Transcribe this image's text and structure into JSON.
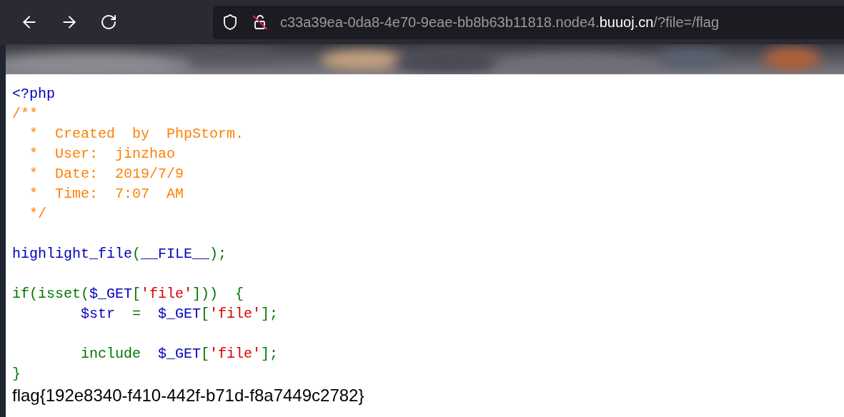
{
  "browser": {
    "url": {
      "prefix": "c33a39ea-0da8-4e70-9eae-bb8b63b11818.node4.",
      "domain": "buuoj.cn",
      "suffix": "/?file=/flag"
    }
  },
  "code": {
    "lines": [
      {
        "kind": "code",
        "tokens": [
          {
            "kind": "default",
            "text": "<?php"
          }
        ]
      },
      {
        "kind": "code",
        "tokens": [
          {
            "kind": "comment",
            "text": "/**"
          }
        ]
      },
      {
        "kind": "code",
        "tokens": [
          {
            "kind": "comment",
            "text": "  *  Created  by  PhpStorm."
          }
        ]
      },
      {
        "kind": "code",
        "tokens": [
          {
            "kind": "comment",
            "text": "  *  User:  jinzhao"
          }
        ]
      },
      {
        "kind": "code",
        "tokens": [
          {
            "kind": "comment",
            "text": "  *  Date:  2019/7/9"
          }
        ]
      },
      {
        "kind": "code",
        "tokens": [
          {
            "kind": "comment",
            "text": "  *  Time:  7:07  AM"
          }
        ]
      },
      {
        "kind": "code",
        "tokens": [
          {
            "kind": "comment",
            "text": "  */"
          }
        ]
      },
      {
        "kind": "blank"
      },
      {
        "kind": "code",
        "tokens": [
          {
            "kind": "default",
            "text": "highlight_file"
          },
          {
            "kind": "keyword",
            "text": "("
          },
          {
            "kind": "default",
            "text": "__FILE__"
          },
          {
            "kind": "keyword",
            "text": ");"
          }
        ]
      },
      {
        "kind": "blank"
      },
      {
        "kind": "code",
        "tokens": [
          {
            "kind": "keyword",
            "text": "if(isset("
          },
          {
            "kind": "default",
            "text": "$_GET"
          },
          {
            "kind": "keyword",
            "text": "["
          },
          {
            "kind": "string",
            "text": "'file'"
          },
          {
            "kind": "keyword",
            "text": "]))  {"
          }
        ]
      },
      {
        "kind": "code",
        "tokens": [
          {
            "kind": "default",
            "text": "        $str"
          },
          {
            "kind": "keyword",
            "text": "  =  "
          },
          {
            "kind": "default",
            "text": "$_GET"
          },
          {
            "kind": "keyword",
            "text": "["
          },
          {
            "kind": "string",
            "text": "'file'"
          },
          {
            "kind": "keyword",
            "text": "];"
          }
        ]
      },
      {
        "kind": "blank"
      },
      {
        "kind": "code",
        "tokens": [
          {
            "kind": "keyword",
            "text": "        include  "
          },
          {
            "kind": "default",
            "text": "$_GET"
          },
          {
            "kind": "keyword",
            "text": "["
          },
          {
            "kind": "string",
            "text": "'file'"
          },
          {
            "kind": "keyword",
            "text": "];"
          }
        ]
      },
      {
        "kind": "code",
        "tokens": [
          {
            "kind": "keyword",
            "text": "}"
          }
        ]
      }
    ]
  },
  "output": "flag{192e8340-f410-442f-b71d-f8a7449c2782}"
}
